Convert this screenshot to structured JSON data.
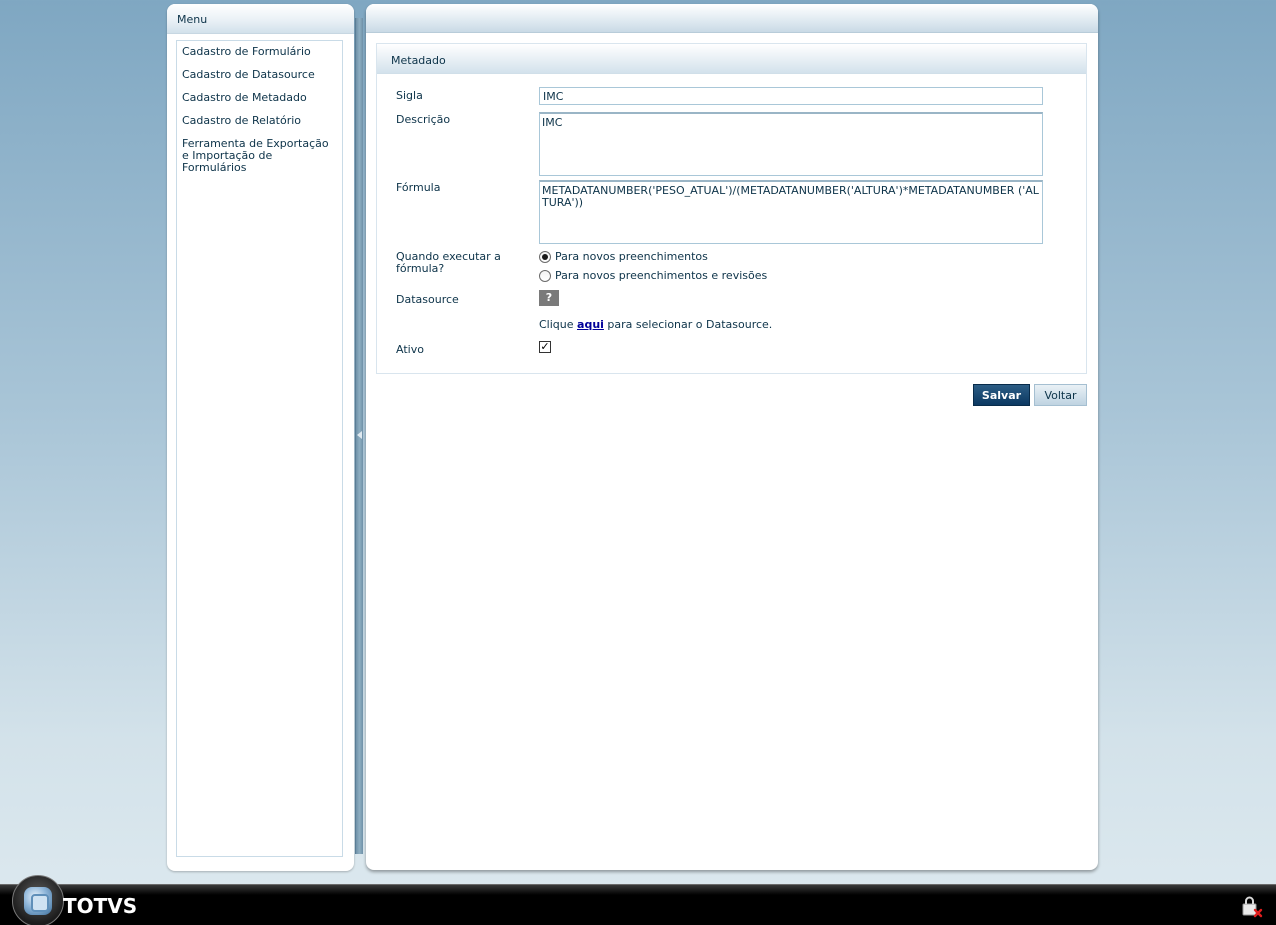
{
  "menu": {
    "title": "Menu",
    "items": [
      {
        "label": "Cadastro de Formulário"
      },
      {
        "label": "Cadastro de Datasource"
      },
      {
        "label": "Cadastro de Metadado"
      },
      {
        "label": "Cadastro de Relatório"
      },
      {
        "label": "Ferramenta de Exportação e Importação de Formulários"
      }
    ]
  },
  "form": {
    "title": "Metadado",
    "sigla_label": "Sigla",
    "sigla_value": "IMC",
    "descricao_label": "Descrição",
    "descricao_value": "IMC",
    "formula_label": "Fórmula",
    "formula_value": "METADATANUMBER('PESO_ATUAL')/(METADATANUMBER('ALTURA')*METADATANUMBER ('ALTURA'))",
    "quando_label": "Quando executar a fórmula?",
    "radio_options": [
      {
        "label": "Para novos preenchimentos",
        "checked": true
      },
      {
        "label": "Para novos preenchimentos e revisões",
        "checked": false
      }
    ],
    "datasource_label": "Datasource",
    "help_glyph": "?",
    "clique_prefix": "Clique ",
    "clique_link": "aqui",
    "clique_suffix": " para selecionar o Datasource.",
    "ativo_label": "Ativo",
    "ativo_checked": true,
    "check_glyph": "✓"
  },
  "buttons": {
    "salvar": "Salvar",
    "voltar": "Voltar"
  },
  "brand": {
    "name": "TOTVS"
  },
  "colors": {
    "primary_text": "#0d3349",
    "accent_button": "#0b3861",
    "link": "#000099"
  }
}
